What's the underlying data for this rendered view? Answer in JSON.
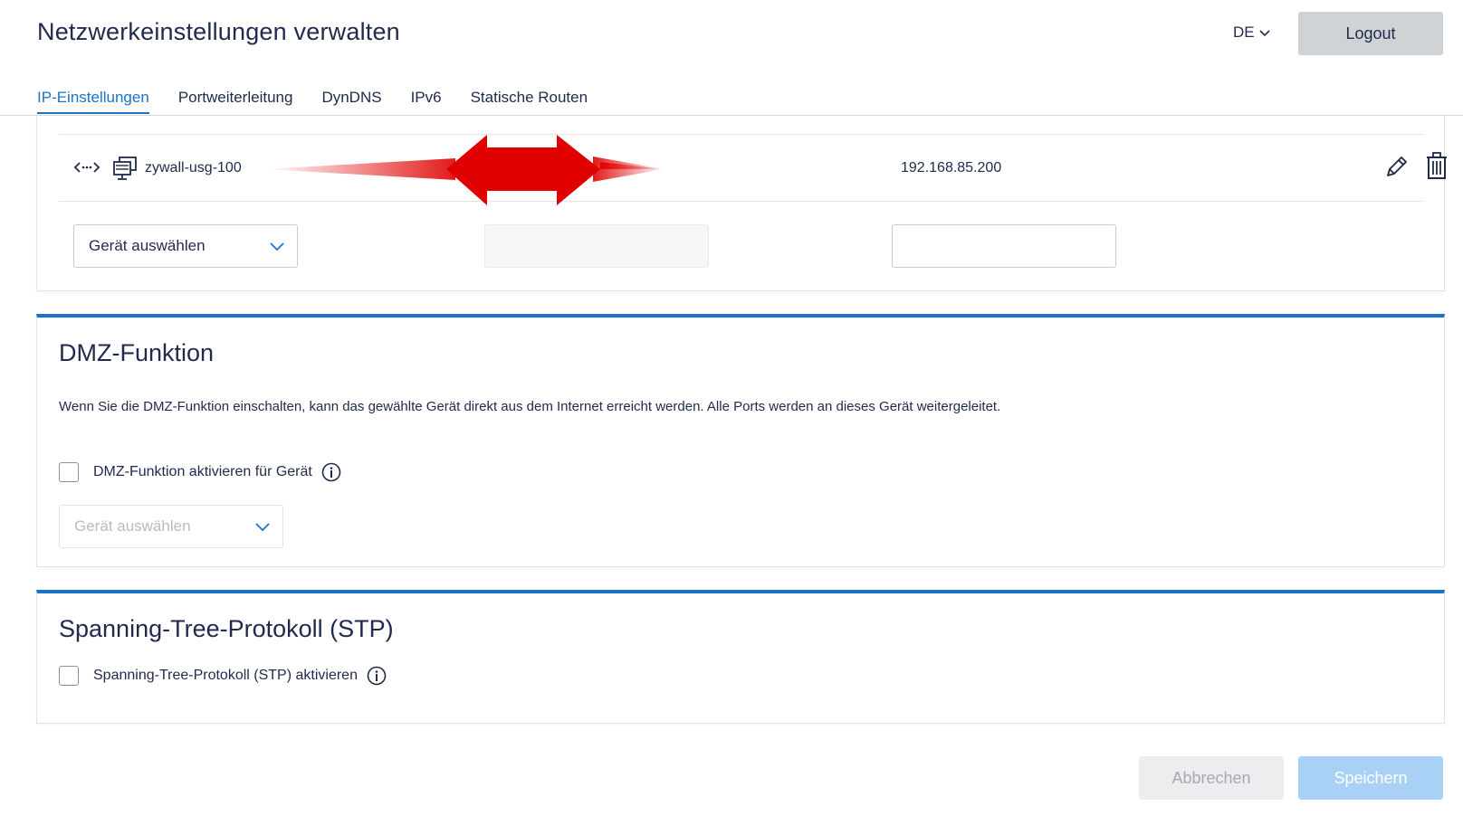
{
  "header": {
    "title": "Netzwerkeinstellungen verwalten",
    "language": "DE",
    "logout_label": "Logout"
  },
  "tabs": [
    {
      "label": "IP-Einstellungen",
      "active": true
    },
    {
      "label": "Portweiterleitung",
      "active": false
    },
    {
      "label": "DynDNS",
      "active": false
    },
    {
      "label": "IPv6",
      "active": false
    },
    {
      "label": "Statische Routen",
      "active": false
    }
  ],
  "ip_table": {
    "row": {
      "device_name": "zywall-usg-100",
      "ip": "192.168.85.200"
    },
    "device_select_placeholder": "Gerät auswählen"
  },
  "dmz": {
    "title": "DMZ-Funktion",
    "description": "Wenn Sie die DMZ-Funktion einschalten, kann das gewählte Gerät direkt aus dem Internet erreicht werden. Alle Ports werden an dieses Gerät weitergeleitet.",
    "checkbox_label": "DMZ-Funktion aktivieren für Gerät",
    "checked": false,
    "device_select_placeholder": "Gerät auswählen"
  },
  "stp": {
    "title": "Spanning-Tree-Protokoll (STP)",
    "checkbox_label": "Spanning-Tree-Protokoll (STP) aktivieren",
    "checked": false
  },
  "footer": {
    "cancel_label": "Abbrechen",
    "save_label": "Speichern"
  },
  "colors": {
    "accent": "#1a73c8",
    "text": "#1f2a4d",
    "redaction": "#e00000"
  }
}
